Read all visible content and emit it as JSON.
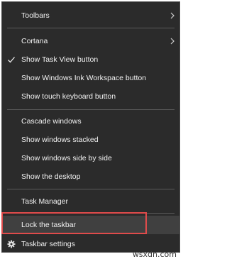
{
  "menu": {
    "toolbars": "Toolbars",
    "cortana": "Cortana",
    "show_task_view": "Show Task View button",
    "show_ink_workspace": "Show Windows Ink Workspace button",
    "show_touch_keyboard": "Show touch keyboard button",
    "cascade_windows": "Cascade windows",
    "show_windows_stacked": "Show windows stacked",
    "show_windows_side_by_side": "Show windows side by side",
    "show_desktop": "Show the desktop",
    "task_manager": "Task Manager",
    "lock_taskbar": "Lock the taskbar",
    "taskbar_settings": "Taskbar settings"
  },
  "icons": {
    "submenu": "chevron-right-icon",
    "checked": "checkmark-icon",
    "settings": "gear-icon"
  },
  "colors": {
    "menu_bg": "#2b2b2b",
    "text": "#f2f2f2",
    "highlight_border": "#e04b4b"
  },
  "state": {
    "task_view_button_checked": true
  },
  "watermark": "wsxdn.com"
}
